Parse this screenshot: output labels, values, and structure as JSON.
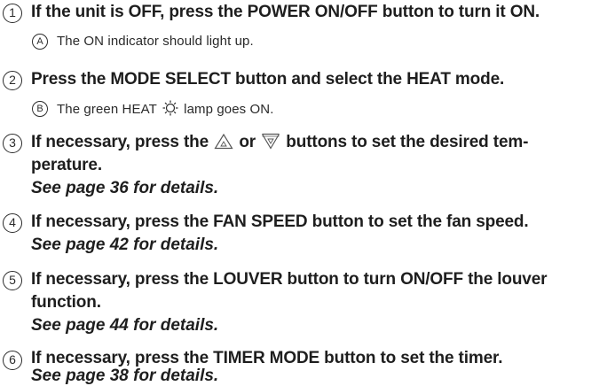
{
  "steps": [
    {
      "marker": "1",
      "text": "If the unit is OFF, press the POWER ON/OFF button to turn it ON.",
      "note_marker": "A",
      "note": "The ON indicator should light up."
    },
    {
      "marker": "2",
      "text": "Press the MODE SELECT button and select the HEAT mode.",
      "note_marker": "B",
      "note_before": "The green HEAT",
      "note_icon": "sun-lamp-icon",
      "note_after": "lamp goes ON."
    },
    {
      "marker": "3",
      "text_part1": "If necessary, press the",
      "icon_up": "up-triangle-icon",
      "text_part2": "or",
      "icon_down": "down-triangle-icon",
      "text_part3": "buttons to set the desired tem-",
      "text_line2": "perature.",
      "see": "See page 36 for details."
    },
    {
      "marker": "4",
      "text": "If necessary, press the FAN SPEED button to set the fan speed.",
      "see": "See page 42 for details."
    },
    {
      "marker": "5",
      "text": "If necessary, press the LOUVER button to turn ON/OFF the louver",
      "text_line2": "function.",
      "see": "See page 44 for details."
    },
    {
      "marker": "6",
      "text": "If necessary, press the TIMER MODE button to set the timer.",
      "see": "See page 38 for details."
    }
  ],
  "colors": {
    "text": "#1e1e1e",
    "icon": "#555555"
  }
}
